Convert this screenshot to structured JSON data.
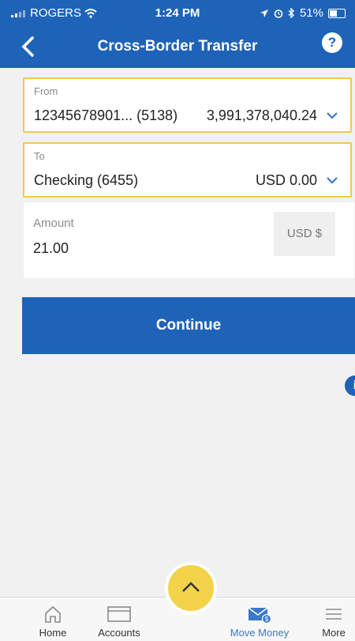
{
  "status_bar": {
    "carrier": "ROGERS",
    "time": "1:24 PM",
    "battery": "51%"
  },
  "header": {
    "title": "Cross-Border Transfer",
    "help_label": "?"
  },
  "from": {
    "label": "From",
    "account": "12345678901... (5138)",
    "balance": "3,991,378,040.24"
  },
  "to": {
    "label": "To",
    "account": "Checking (6455)",
    "balance": "USD 0.00"
  },
  "amount": {
    "label": "Amount",
    "value": "21.00",
    "currency": "USD $"
  },
  "continue_label": "Continue",
  "info_label": "i",
  "tabs": [
    {
      "label": "Home",
      "icon": "home-icon"
    },
    {
      "label": "Accounts",
      "icon": "accounts-icon"
    },
    {
      "label": "Move Money",
      "icon": "move-money-icon",
      "active": true
    },
    {
      "label": "More",
      "icon": "menu-icon"
    }
  ],
  "colors": {
    "brand": "#1f63b8",
    "highlight": "#f2c94c",
    "fab": "#f3d34a"
  }
}
